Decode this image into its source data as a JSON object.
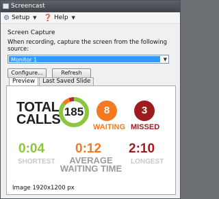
{
  "window": {
    "title": "Screencast",
    "icon": "screencast-app-icon"
  },
  "menu": {
    "items": [
      {
        "label": "Setup",
        "icon": "gear-icon",
        "glyph": "⚙"
      },
      {
        "label": "Help",
        "icon": "help-icon",
        "glyph": "❓"
      }
    ]
  },
  "capture": {
    "heading": "Screen Capture",
    "instruction": "When recording, capture the screen from the following source:",
    "source_selected": "Monitor 1",
    "configure_label": "Configure...",
    "refresh_label": "Refresh"
  },
  "tabs": [
    {
      "label": "Preview",
      "active": true
    },
    {
      "label": "Last Saved Slide",
      "active": false
    }
  ],
  "preview": {
    "total_line1": "TOTAL",
    "total_line2": "CALLS",
    "total_calls": "185",
    "ring_fraction_green": 0.86,
    "waiting_count": "8",
    "waiting_label": "WAITING",
    "missed_count": "3",
    "missed_label": "MISSED",
    "shortest_time": "0:04",
    "shortest_label": "SHORTEST",
    "average_time": "0:12",
    "average_label_1": "AVERAGE",
    "average_label_2": "WAITING TIME",
    "longest_time": "2:10",
    "longest_label": "LONGEST",
    "colors": {
      "green": "#8cc63f",
      "orange": "#f47920",
      "red": "#c1272d",
      "dark_red": "#9e1b1e",
      "ring_track": "#e0e0e0"
    }
  },
  "footer": {
    "image_info": "Image 1920x1200 px"
  }
}
